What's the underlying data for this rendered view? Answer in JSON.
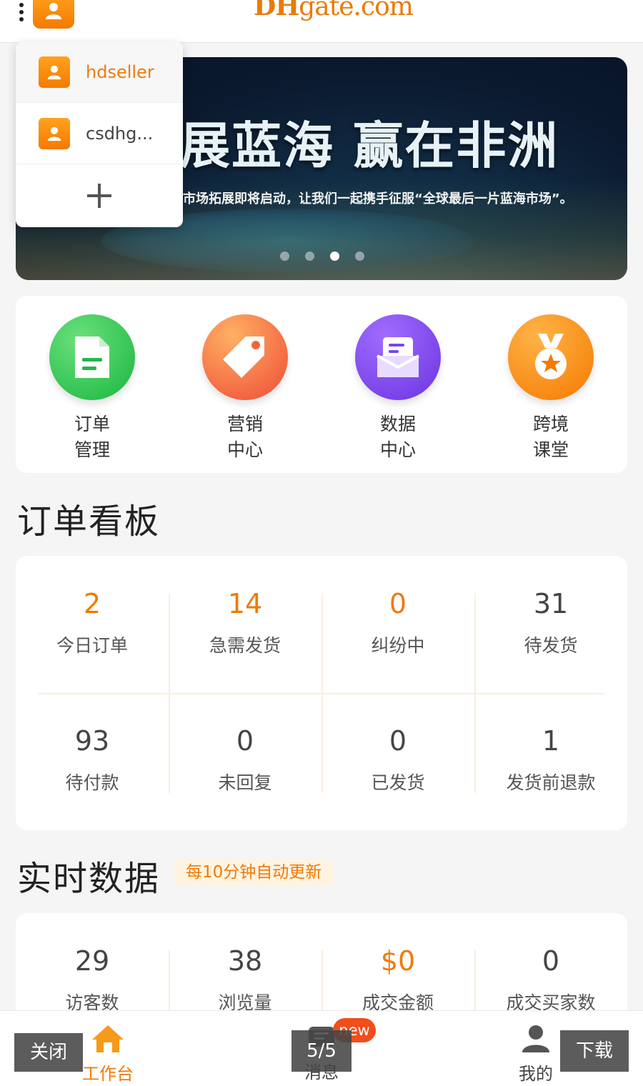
{
  "header": {
    "logo_bold": "DH",
    "logo_rest": "gate.com"
  },
  "banner": {
    "headline": "展蓝海  赢在非洲",
    "subtext": "市场拓展即将启动，让我们一起携手征服“全球最后一片蓝海市场”。",
    "active_slide": 3,
    "slide_count": 4
  },
  "accounts": {
    "items": [
      {
        "name": "hdseller",
        "active": true
      },
      {
        "name": "csdhg...",
        "active": false
      }
    ],
    "add_symbol": "+"
  },
  "quick_menu": [
    {
      "line1": "订单",
      "line2": "管理",
      "color": "#2fc94f",
      "icon": "document-icon"
    },
    {
      "line1": "营销",
      "line2": "中心",
      "color": "#f25f3a",
      "icon": "tag-icon"
    },
    {
      "line1": "数据",
      "line2": "中心",
      "color": "#7a46e6",
      "icon": "data-box-icon"
    },
    {
      "line1": "跨境",
      "line2": "课堂",
      "color": "#f78a0c",
      "icon": "medal-icon"
    }
  ],
  "order_board": {
    "title": "订单看板",
    "stats": [
      {
        "value": "2",
        "label": "今日订单",
        "highlight": true
      },
      {
        "value": "14",
        "label": "急需发货",
        "highlight": true
      },
      {
        "value": "0",
        "label": "纠纷中",
        "highlight": true
      },
      {
        "value": "31",
        "label": "待发货",
        "highlight": false
      },
      {
        "value": "93",
        "label": "待付款",
        "highlight": false
      },
      {
        "value": "0",
        "label": "未回复",
        "highlight": false
      },
      {
        "value": "0",
        "label": "已发货",
        "highlight": false
      },
      {
        "value": "1",
        "label": "发货前退款",
        "highlight": false
      }
    ]
  },
  "realtime": {
    "title": "实时数据",
    "badge": "每10分钟自动更新",
    "stats": [
      {
        "value": "29",
        "label": "访客数",
        "highlight": false
      },
      {
        "value": "38",
        "label": "浏览量",
        "highlight": false
      },
      {
        "value": "$0",
        "label": "成交金额",
        "highlight": true
      },
      {
        "value": "0",
        "label": "成交买家数",
        "highlight": false
      }
    ]
  },
  "tabbar": {
    "workbench": "工作台",
    "messages": "消息",
    "new_badge": "new",
    "mine": "我的",
    "close": "关闭",
    "page": "5/5",
    "download": "下载"
  },
  "colors": {
    "brand_orange": "#f07a0a",
    "divider": "#fbeede"
  }
}
